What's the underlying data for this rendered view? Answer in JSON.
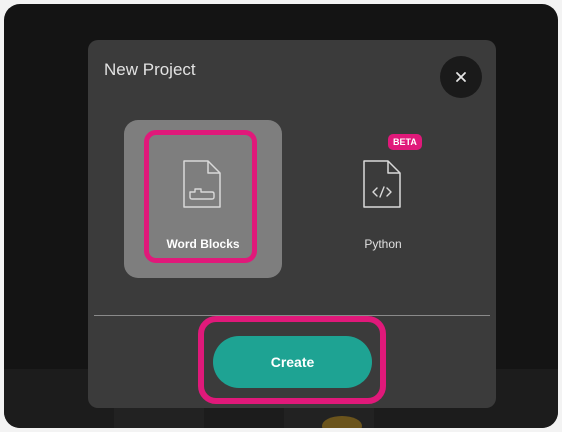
{
  "modal": {
    "title": "New Project",
    "close_icon": "close-icon"
  },
  "options": [
    {
      "label": "Word Blocks",
      "icon": "file-blocks-icon",
      "selected": true
    },
    {
      "label": "Python",
      "icon": "file-code-icon",
      "badge": "BETA",
      "selected": false
    }
  ],
  "actions": {
    "create_label": "Create"
  },
  "colors": {
    "accent_teal": "#1ea393",
    "highlight_pink": "#e0197a",
    "modal_bg": "#3b3b3b",
    "selected_tile": "#7e7e7e"
  }
}
